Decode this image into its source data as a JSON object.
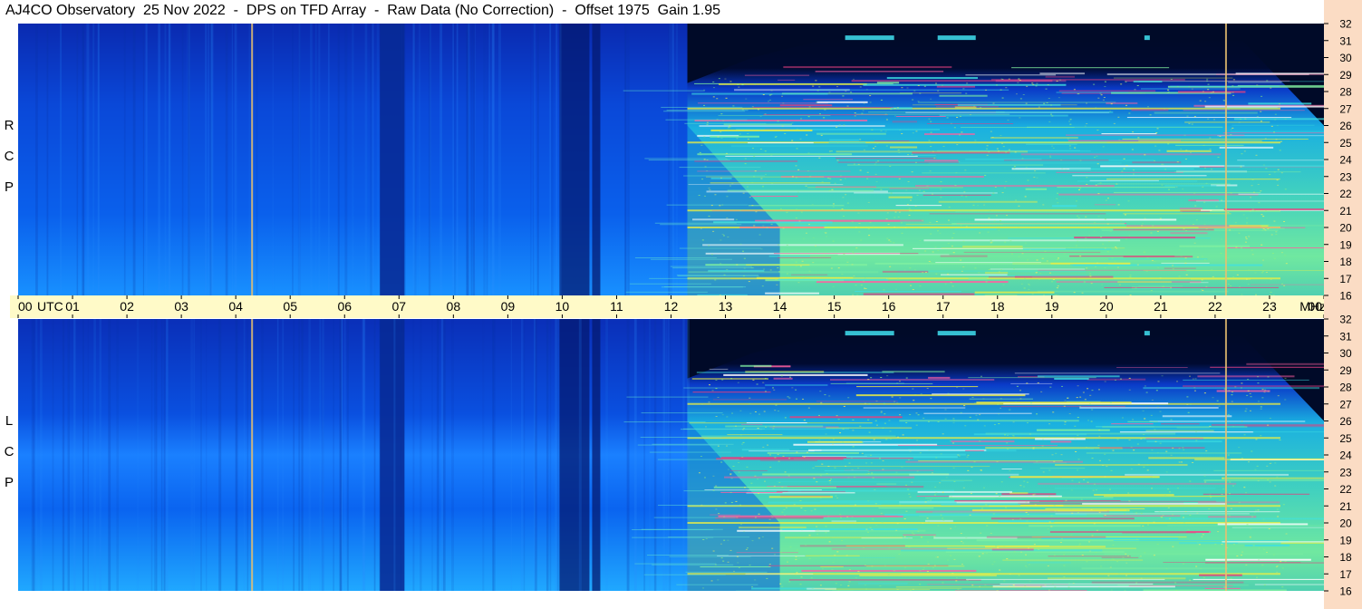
{
  "header": {
    "title": "AJ4CO Observatory  25 Nov 2022  -  DPS on TFD Array  -  Raw Data (No Correction)  -  Offset 1975  Gain 1.95"
  },
  "polarizations": {
    "top": [
      "R",
      "C",
      "P"
    ],
    "bottom": [
      "L",
      "C",
      "P"
    ]
  },
  "chart_data": {
    "type": "heatmap",
    "title": "AJ4CO Observatory  25 Nov 2022  -  DPS on TFD Array  -  Raw Data (No Correction)  -  Offset 1975  Gain 1.95",
    "x_axis": {
      "unit_label": "UTC",
      "ticks": [
        "00",
        "01",
        "02",
        "03",
        "04",
        "05",
        "06",
        "07",
        "08",
        "09",
        "10",
        "11",
        "12",
        "13",
        "14",
        "15",
        "16",
        "17",
        "18",
        "19",
        "20",
        "21",
        "22",
        "23",
        "00"
      ],
      "range_hours": [
        0,
        24
      ]
    },
    "y_axis": {
      "unit_label": "MHz",
      "ticks": [
        "32",
        "31",
        "30",
        "29",
        "28",
        "27",
        "26",
        "25",
        "24",
        "23",
        "22",
        "21",
        "20",
        "19",
        "18",
        "17",
        "16"
      ],
      "range_mhz": [
        16,
        32
      ]
    },
    "panels": [
      {
        "name": "RCP",
        "polarization": "R C P"
      },
      {
        "name": "LCP",
        "polarization": "L C P"
      }
    ],
    "observed_features": {
      "ionospheric_cutoff_onset_utc": 12.3,
      "dark_gaps_utc": [
        [
          6.65,
          7.1
        ],
        [
          9.95,
          10.5
        ],
        [
          10.55,
          10.7
        ]
      ],
      "vertical_marker_lines_utc": [
        4.3,
        22.2
      ],
      "strong_band_mhz": [
        27,
        25,
        21,
        20,
        17
      ]
    },
    "colormap": [
      "#000018",
      "#001060",
      "#0040c8",
      "#0070ff",
      "#20a0ff",
      "#40d0e0",
      "#80f0a0",
      "#f0f040",
      "#ff60a0"
    ]
  }
}
